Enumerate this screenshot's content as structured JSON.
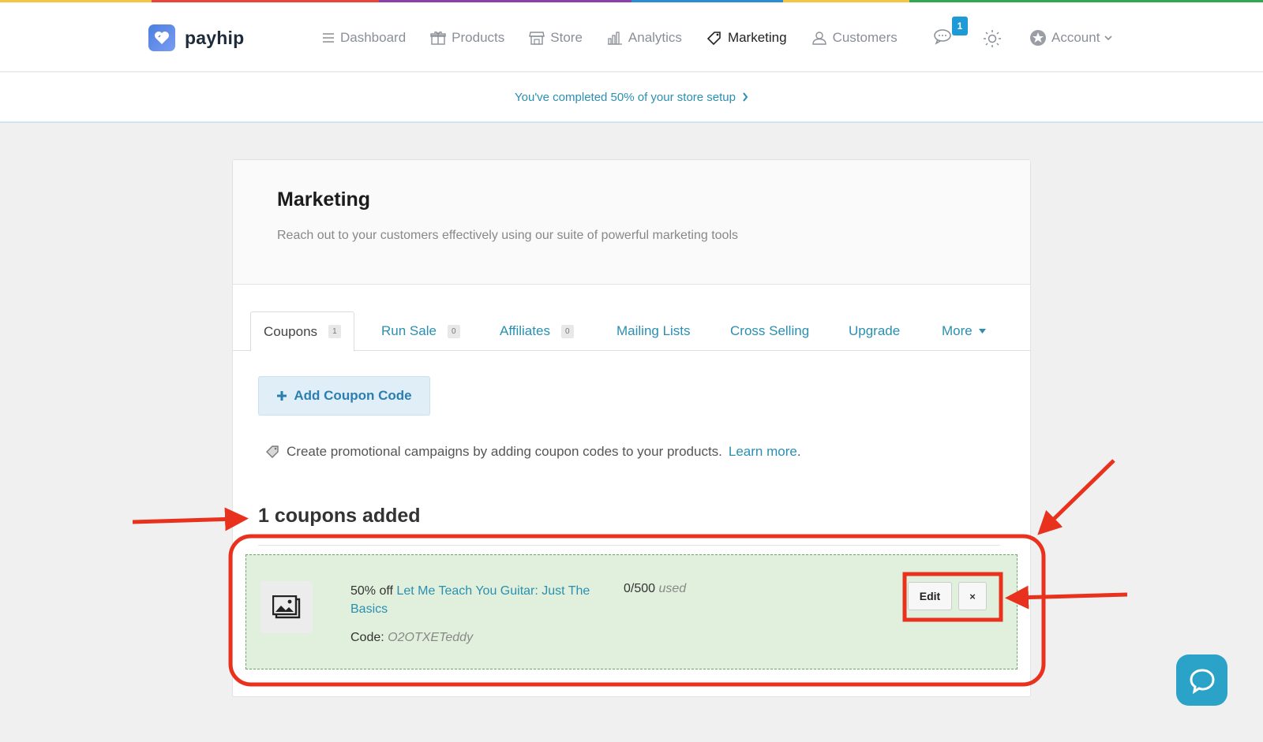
{
  "brand": {
    "name": "payhip"
  },
  "nav": {
    "dashboard": "Dashboard",
    "products": "Products",
    "store": "Store",
    "analytics": "Analytics",
    "marketing": "Marketing",
    "customers": "Customers",
    "chat_badge": "1",
    "account": "Account"
  },
  "setup": {
    "text": "You've completed 50% of your store setup"
  },
  "page": {
    "title": "Marketing",
    "subtitle": "Reach out to your customers effectively using our suite of powerful marketing tools"
  },
  "tabs": [
    {
      "label": "Coupons",
      "count": "1"
    },
    {
      "label": "Run Sale",
      "count": "0"
    },
    {
      "label": "Affiliates",
      "count": "0"
    },
    {
      "label": "Mailing Lists"
    },
    {
      "label": "Cross Selling"
    },
    {
      "label": "Upgrade"
    },
    {
      "label": "More"
    }
  ],
  "coupons": {
    "add_button": "Add Coupon Code",
    "promo_text": "Create promotional campaigns by adding coupon codes to your products.",
    "learn_more": "Learn more",
    "count_heading": "1 coupons added",
    "items": [
      {
        "discount": "50% off",
        "product": "Let Me Teach You Guitar: Just The Basics",
        "code_label": "Code:",
        "code": "O2OTXETeddy",
        "used_count": "0/500",
        "used_label": "used",
        "edit_label": "Edit",
        "delete_label": "×"
      }
    ]
  },
  "colors": {
    "accent": "#2a8fb0",
    "annotation": "#e8321e",
    "coupon_bg": "#e1f0dc",
    "help_button": "#2ba3c9"
  }
}
